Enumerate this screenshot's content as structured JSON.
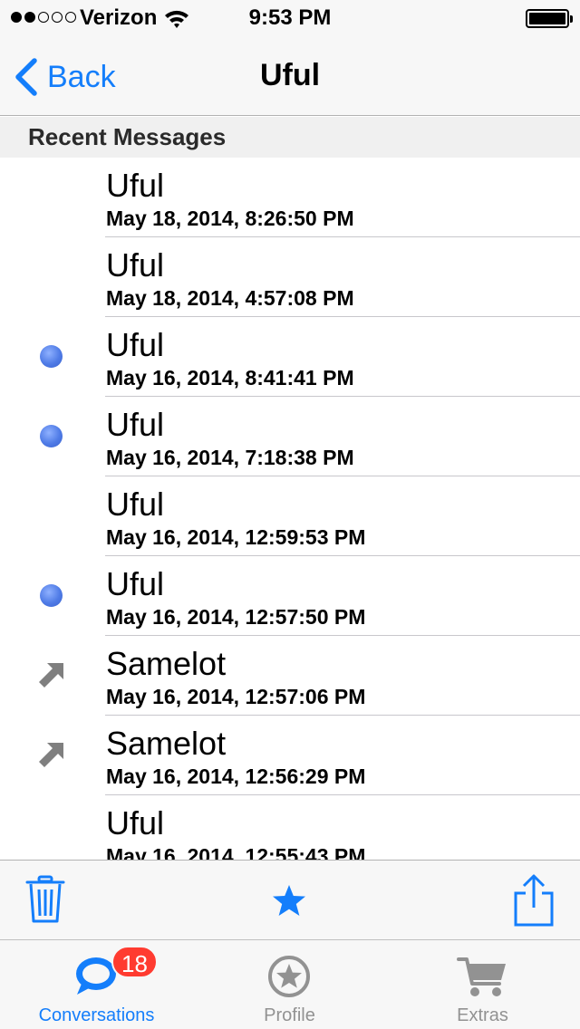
{
  "status_bar": {
    "carrier": "Verizon",
    "signal_bars_filled": 2,
    "signal_bars_total": 5,
    "time": "9:53 PM"
  },
  "nav": {
    "back_label": "Back",
    "title": "Uful"
  },
  "section": {
    "title": "Recent Messages"
  },
  "messages": [
    {
      "name": "Uful",
      "date": "May 18, 2014, 8:26:50 PM",
      "indicator": "none"
    },
    {
      "name": "Uful",
      "date": "May 18, 2014, 4:57:08 PM",
      "indicator": "none"
    },
    {
      "name": "Uful",
      "date": "May 16, 2014, 8:41:41 PM",
      "indicator": "unread-dot"
    },
    {
      "name": "Uful",
      "date": "May 16, 2014, 7:18:38 PM",
      "indicator": "unread-dot"
    },
    {
      "name": "Uful",
      "date": "May 16, 2014, 12:59:53 PM",
      "indicator": "none"
    },
    {
      "name": "Uful",
      "date": "May 16, 2014, 12:57:50 PM",
      "indicator": "unread-dot"
    },
    {
      "name": "Samelot",
      "date": "May 16, 2014, 12:57:06 PM",
      "indicator": "sent-arrow"
    },
    {
      "name": "Samelot",
      "date": "May 16, 2014, 12:56:29 PM",
      "indicator": "sent-arrow"
    },
    {
      "name": "Uful",
      "date": "May 16, 2014, 12:55:43 PM",
      "indicator": "none"
    }
  ],
  "toolbar": {
    "icons": [
      "trash-icon",
      "star-icon",
      "share-icon"
    ]
  },
  "tabs": [
    {
      "label": "Conversations",
      "icon": "chat-bubble-icon",
      "badge": "18",
      "active": true
    },
    {
      "label": "Profile",
      "icon": "star-circle-icon",
      "active": false
    },
    {
      "label": "Extras",
      "icon": "cart-icon",
      "active": false
    }
  ],
  "colors": {
    "accent": "#147efb",
    "badge": "#ff3b30",
    "unread_dot": "#4f7be6",
    "inactive": "#929292",
    "bar_background": "#f7f7f7"
  }
}
